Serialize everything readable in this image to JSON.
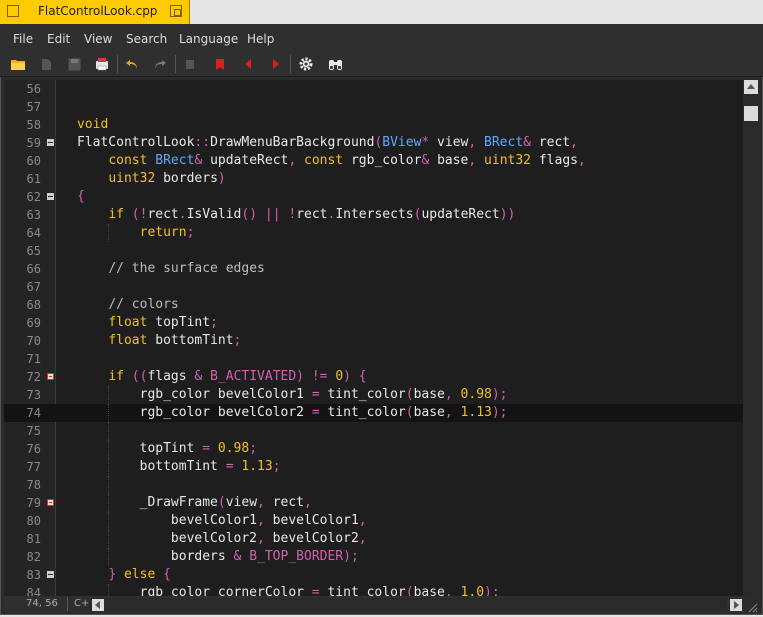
{
  "tab": {
    "title": "FlatControlLook.cpp"
  },
  "menu": {
    "items": [
      "File",
      "Edit",
      "View",
      "Search",
      "Language",
      "Help"
    ]
  },
  "toolbar": {
    "icons": [
      "open-icon",
      "reload-icon",
      "save-icon",
      "print-icon",
      "undo-icon",
      "redo-icon",
      "cut-icon",
      "bookmark-icon",
      "prev-bookmark-icon",
      "next-bookmark-icon",
      "settings-icon",
      "find-icon"
    ]
  },
  "colors": {
    "tab": "#ffcb00",
    "keyword": "#f0c020",
    "type": "#5fa8ff",
    "operator": "#d060b0",
    "background": "#1e1e1e"
  },
  "editor": {
    "current_line": "74",
    "lines": [
      {
        "n": "56",
        "t": []
      },
      {
        "n": "57",
        "t": []
      },
      {
        "n": "58",
        "t": [
          [
            "kw",
            "void"
          ]
        ]
      },
      {
        "n": "59",
        "fold": "box",
        "t": [
          [
            "id",
            "FlatControlLook"
          ],
          [
            "op",
            "::"
          ],
          [
            "id",
            "DrawMenuBarBackground"
          ],
          [
            "op",
            "("
          ],
          [
            "kw2",
            "BView"
          ],
          [
            "op",
            "*"
          ],
          [
            "id",
            " view"
          ],
          [
            "op",
            ", "
          ],
          [
            "kw2",
            "BRect"
          ],
          [
            "op",
            "&"
          ],
          [
            "id",
            " rect"
          ],
          [
            "op",
            ","
          ]
        ]
      },
      {
        "n": "60",
        "t": [
          [
            "id",
            "    "
          ],
          [
            "kw",
            "const "
          ],
          [
            "kw2",
            "BRect"
          ],
          [
            "op",
            "&"
          ],
          [
            "id",
            " updateRect"
          ],
          [
            "op",
            ", "
          ],
          [
            "kw",
            "const "
          ],
          [
            "id",
            "rgb_color"
          ],
          [
            "op",
            "&"
          ],
          [
            "id",
            " base"
          ],
          [
            "op",
            ", "
          ],
          [
            "kw",
            "uint32"
          ],
          [
            "id",
            " flags"
          ],
          [
            "op",
            ","
          ]
        ]
      },
      {
        "n": "61",
        "t": [
          [
            "id",
            "    "
          ],
          [
            "kw",
            "uint32"
          ],
          [
            "id",
            " borders"
          ],
          [
            "op",
            ")"
          ]
        ]
      },
      {
        "n": "62",
        "fold": "box",
        "t": [
          [
            "op",
            "{"
          ]
        ]
      },
      {
        "n": "63",
        "t": [
          [
            "id",
            "    "
          ],
          [
            "kw",
            "if "
          ],
          [
            "op",
            "(!"
          ],
          [
            "id",
            "rect"
          ],
          [
            "op",
            "."
          ],
          [
            "id",
            "IsValid"
          ],
          [
            "op",
            "() || !"
          ],
          [
            "id",
            "rect"
          ],
          [
            "op",
            "."
          ],
          [
            "id",
            "Intersects"
          ],
          [
            "op",
            "("
          ],
          [
            "id",
            "updateRect"
          ],
          [
            "op",
            "))"
          ]
        ]
      },
      {
        "n": "64",
        "guide": true,
        "t": [
          [
            "id",
            "        "
          ],
          [
            "kw",
            "return"
          ],
          [
            "op",
            ";"
          ]
        ]
      },
      {
        "n": "65",
        "t": []
      },
      {
        "n": "66",
        "t": [
          [
            "id",
            "    "
          ],
          [
            "cm",
            "// the surface edges"
          ]
        ]
      },
      {
        "n": "67",
        "t": []
      },
      {
        "n": "68",
        "t": [
          [
            "id",
            "    "
          ],
          [
            "cm",
            "// colors"
          ]
        ]
      },
      {
        "n": "69",
        "t": [
          [
            "id",
            "    "
          ],
          [
            "kw",
            "float"
          ],
          [
            "id",
            " topTint"
          ],
          [
            "op",
            ";"
          ]
        ]
      },
      {
        "n": "70",
        "t": [
          [
            "id",
            "    "
          ],
          [
            "kw",
            "float"
          ],
          [
            "id",
            " bottomTint"
          ],
          [
            "op",
            ";"
          ]
        ]
      },
      {
        "n": "71",
        "t": []
      },
      {
        "n": "72",
        "fold": "red",
        "t": [
          [
            "id",
            "    "
          ],
          [
            "kw",
            "if "
          ],
          [
            "op",
            "(("
          ],
          [
            "id",
            "flags"
          ],
          [
            "op",
            " & "
          ],
          [
            "op",
            "B_ACTIVATED"
          ],
          [
            "op",
            ") != "
          ],
          [
            "num",
            "0"
          ],
          [
            "op",
            ") {"
          ]
        ]
      },
      {
        "n": "73",
        "guide": true,
        "t": [
          [
            "id",
            "        rgb_color bevelColor1 "
          ],
          [
            "op",
            "= "
          ],
          [
            "id",
            "tint_color"
          ],
          [
            "op",
            "("
          ],
          [
            "id",
            "base"
          ],
          [
            "op",
            ", "
          ],
          [
            "num",
            "0.98"
          ],
          [
            "op",
            ");"
          ]
        ]
      },
      {
        "n": "74",
        "guide": true,
        "t": [
          [
            "id",
            "        rgb_color bevelColor2 "
          ],
          [
            "op",
            "= "
          ],
          [
            "id",
            "tint_color"
          ],
          [
            "op",
            "("
          ],
          [
            "id",
            "base"
          ],
          [
            "op",
            ", "
          ],
          [
            "num",
            "1.13"
          ],
          [
            "op",
            ");"
          ]
        ]
      },
      {
        "n": "75",
        "guide": true,
        "t": []
      },
      {
        "n": "76",
        "guide": true,
        "t": [
          [
            "id",
            "        topTint "
          ],
          [
            "op",
            "= "
          ],
          [
            "num",
            "0.98"
          ],
          [
            "op",
            ";"
          ]
        ]
      },
      {
        "n": "77",
        "guide": true,
        "t": [
          [
            "id",
            "        bottomTint "
          ],
          [
            "op",
            "= "
          ],
          [
            "num",
            "1.13"
          ],
          [
            "op",
            ";"
          ]
        ]
      },
      {
        "n": "78",
        "guide": true,
        "t": []
      },
      {
        "n": "79",
        "fold": "red",
        "guide": true,
        "t": [
          [
            "id",
            "        _DrawFrame"
          ],
          [
            "op",
            "("
          ],
          [
            "id",
            "view"
          ],
          [
            "op",
            ", "
          ],
          [
            "id",
            "rect"
          ],
          [
            "op",
            ","
          ]
        ]
      },
      {
        "n": "80",
        "guide": true,
        "t": [
          [
            "id",
            "            bevelColor1"
          ],
          [
            "op",
            ", "
          ],
          [
            "id",
            "bevelColor1"
          ],
          [
            "op",
            ","
          ]
        ]
      },
      {
        "n": "81",
        "guide": true,
        "t": [
          [
            "id",
            "            bevelColor2"
          ],
          [
            "op",
            ", "
          ],
          [
            "id",
            "bevelColor2"
          ],
          [
            "op",
            ","
          ]
        ]
      },
      {
        "n": "82",
        "guide": true,
        "t": [
          [
            "id",
            "            borders "
          ],
          [
            "op",
            "& "
          ],
          [
            "op",
            "B_TOP_BORDER"
          ],
          [
            "op",
            ");"
          ]
        ]
      },
      {
        "n": "83",
        "fold": "box",
        "t": [
          [
            "id",
            "    "
          ],
          [
            "op",
            "} "
          ],
          [
            "kw",
            "else "
          ],
          [
            "op",
            "{"
          ]
        ]
      },
      {
        "n": "84",
        "guide": true,
        "t": [
          [
            "id",
            "        rgb_color cornerColor "
          ],
          [
            "op",
            "= "
          ],
          [
            "id",
            "tint_color"
          ],
          [
            "op",
            "("
          ],
          [
            "id",
            "base"
          ],
          [
            "op",
            ", "
          ],
          [
            "num",
            "1.0"
          ],
          [
            "op",
            ");"
          ]
        ]
      }
    ]
  },
  "status": {
    "position": "74, 56",
    "language": "C++"
  }
}
